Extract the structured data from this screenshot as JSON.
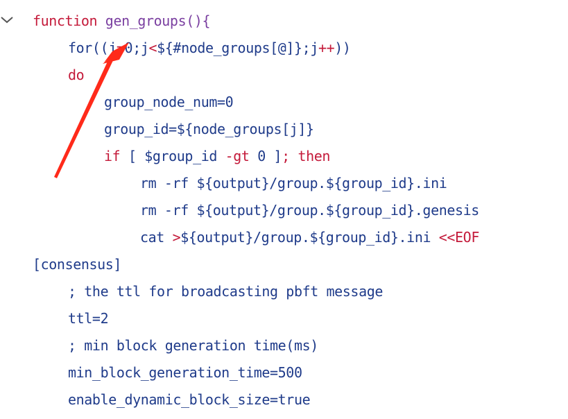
{
  "colors": {
    "keyword": "#c41a3a",
    "function_name": "#7a3fa0",
    "text": "#1f3b8a",
    "arrow": "#ff2a1a"
  },
  "fold_icon": "chevron-down-icon",
  "code": {
    "l1": {
      "kw": "function",
      "name": "gen_groups",
      "rest": "(){"
    },
    "l2": {
      "a": "for((",
      "b": "j",
      "c": "=",
      "d": "0",
      "e": ";j",
      "f": "<",
      "g": "${#node_groups[@]};j",
      "h": "++",
      "i": "))"
    },
    "l3": {
      "kw": "do"
    },
    "l4": {
      "text": "group_node_num=0"
    },
    "l5": {
      "text": "group_id=${node_groups[j]}"
    },
    "l6": {
      "a": "if",
      "b": " [ $group_id ",
      "c": "-gt",
      "d": " 0 ]",
      "e": ";",
      "f": " then"
    },
    "l7": {
      "text": "rm -rf ${output}/group.${group_id}.ini"
    },
    "l8": {
      "text": "rm -rf ${output}/group.${group_id}.genesis"
    },
    "l9": {
      "a": "cat ",
      "b": ">",
      "c": "${output}/group.${group_id}.ini ",
      "d": "<<EOF"
    },
    "l10": {
      "text": "[consensus]"
    },
    "l11": {
      "text": "; the ttl for broadcasting pbft message"
    },
    "l12": {
      "text": "ttl=2"
    },
    "l13": {
      "text": "; min block generation time(ms)"
    },
    "l14": {
      "text": "min_block_generation_time=500"
    },
    "l15": {
      "text": "enable_dynamic_block_size=true"
    }
  }
}
